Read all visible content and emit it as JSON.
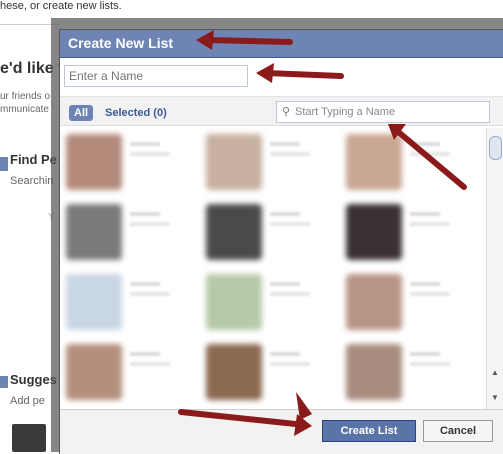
{
  "background": {
    "top_text": "hese, or create new lists.",
    "heading": "e'd like t",
    "line1": "ur friends o",
    "line2": "mmunicate",
    "find_heading": "Find Pe",
    "find_sub": "Searchin",
    "faded_letter": "Y",
    "suggest_heading": "Sugges",
    "suggest_sub": "Add pe"
  },
  "dialog": {
    "title": "Create New List",
    "name_placeholder": "Enter a Name",
    "filter_all": "All",
    "filter_selected": "Selected (0)",
    "search_placeholder": "Start Typing a Name",
    "search_icon": "magnifier-icon",
    "create_button": "Create List",
    "cancel_button": "Cancel"
  },
  "friends": [
    {
      "color": "#b48a7a"
    },
    {
      "color": "#c7b0a0"
    },
    {
      "color": "#c9a793"
    },
    {
      "color": "#7a7a7a"
    },
    {
      "color": "#4a4a4a"
    },
    {
      "color": "#3a3232"
    },
    {
      "color": "#c9d6e6"
    },
    {
      "color": "#b7c9a8"
    },
    {
      "color": "#b89484"
    },
    {
      "color": "#b38f7c"
    },
    {
      "color": "#8b6a52"
    },
    {
      "color": "#a88c7e"
    }
  ],
  "colors": {
    "title_bar": "#6d84b4",
    "primary_button": "#5b74a8",
    "arrow": "#8b1a1a"
  }
}
